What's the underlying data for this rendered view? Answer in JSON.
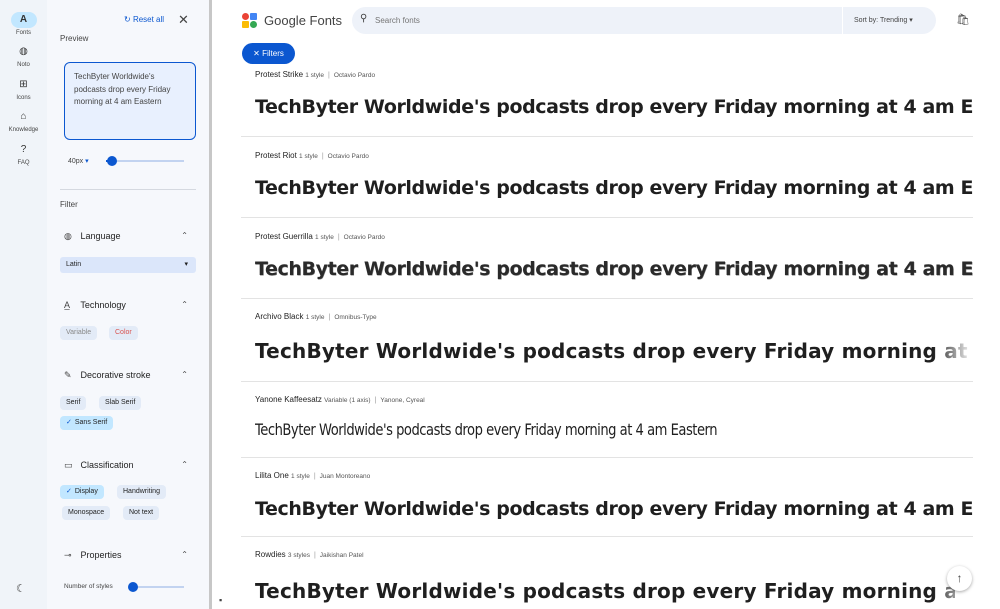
{
  "rail": [
    {
      "label": "Fonts",
      "icon": "fonts-icon",
      "glyph": "A",
      "active": true
    },
    {
      "label": "Noto",
      "icon": "globe-icon",
      "glyph": "◍",
      "active": false
    },
    {
      "label": "Icons",
      "icon": "shapes-icon",
      "glyph": "⊞",
      "active": false
    },
    {
      "label": "Knowledge",
      "icon": "school-icon",
      "glyph": "⌂",
      "active": false
    },
    {
      "label": "FAQ",
      "icon": "help-icon",
      "glyph": "?",
      "active": false
    }
  ],
  "panel": {
    "reset_label": "Reset all",
    "preview_title": "Preview",
    "preview_text": "TechByter Worldwide's podcasts drop every Friday morning at 4 am Eastern",
    "size_value": "40px",
    "filter_title": "Filter",
    "language": {
      "title": "Language",
      "selected": "Latin"
    },
    "technology": {
      "title": "Technology",
      "chips": [
        "Variable",
        "Color"
      ]
    },
    "decorative": {
      "title": "Decorative stroke",
      "chips": [
        "Serif",
        "Slab Serif",
        "Sans Serif"
      ]
    },
    "classification": {
      "title": "Classification",
      "chips": [
        "Display",
        "Handwriting",
        "Monospace",
        "Not text"
      ]
    },
    "properties": {
      "title": "Properties",
      "number_of_styles_label": "Number of styles"
    }
  },
  "header": {
    "logo_text": "Google Fonts",
    "search_placeholder": "Search fonts",
    "sort_label": "Sort by: Trending",
    "filters_label": "Filters"
  },
  "fonts": [
    {
      "name": "Protest Strike",
      "styles": "1 style",
      "designer": "Octavio Pardo"
    },
    {
      "name": "Protest Riot",
      "styles": "1 style",
      "designer": "Octavio Pardo"
    },
    {
      "name": "Protest Guerrilla",
      "styles": "1 style",
      "designer": "Octavio Pardo"
    },
    {
      "name": "Archivo Black",
      "styles": "1 style",
      "designer": "Omnibus-Type"
    },
    {
      "name": "Yanone Kaffeesatz",
      "styles": "Variable (1 axis)",
      "designer": "Yanone, Cyreal"
    },
    {
      "name": "Lilita One",
      "styles": "1 style",
      "designer": "Juan Montoreano"
    },
    {
      "name": "Rowdies",
      "styles": "3 styles",
      "designer": "Jaikishan Patel"
    }
  ],
  "sample_text": "TechByter Worldwide's podcasts drop every Friday morning at 4 am Eastern",
  "colors": {
    "accent": "#0b57d0",
    "chip_selected": "#c2e7ff",
    "rail_bg": "#f0f4f9"
  }
}
